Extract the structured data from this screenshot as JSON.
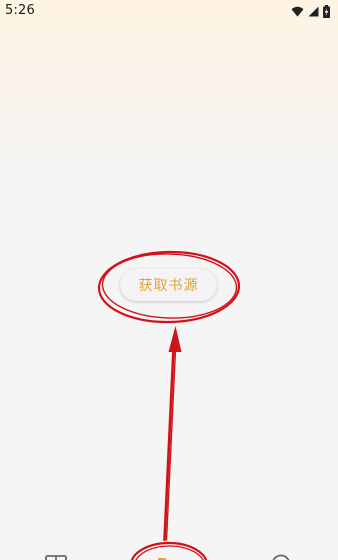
{
  "status_bar": {
    "time": "5:26",
    "icons": [
      "wifi-icon",
      "cellular-signal-icon",
      "battery-charging-icon"
    ]
  },
  "main": {
    "get_source_button_label": "获取书源"
  },
  "bottom_nav": {
    "items": [
      "bookshelf-icon",
      "folder-icon",
      "discover-icon"
    ]
  },
  "annotation": {
    "color": "#d0121b"
  },
  "colors": {
    "accent_text": "#e0a33a",
    "annotation_red": "#d0121b",
    "background": "#f5f5f5"
  }
}
